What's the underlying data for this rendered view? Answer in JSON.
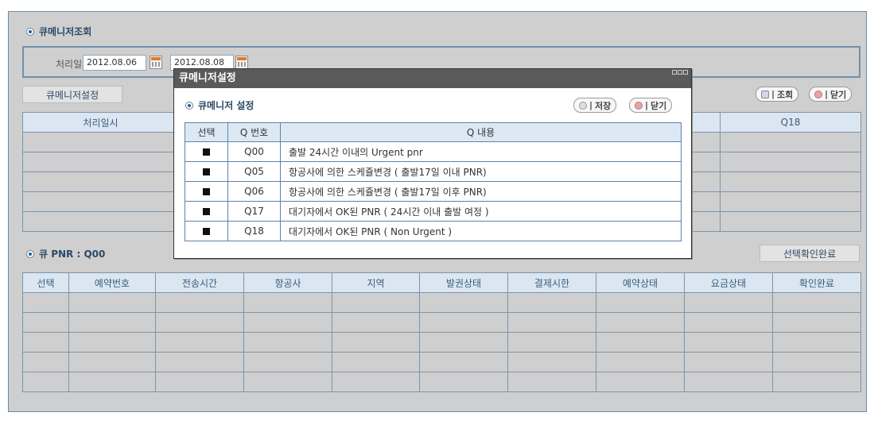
{
  "query": {
    "section_title": "큐메니저조회",
    "date_label": "처리일",
    "date_from": "2012.08.06",
    "date_to": "2012.08.08"
  },
  "settings_button": "큐메니저설정",
  "toolbar": {
    "search_label": "조회",
    "close_label": "닫기"
  },
  "q_table": {
    "headers": [
      "처리일시",
      "Q18"
    ],
    "row_count": 5
  },
  "pnr_section": {
    "title": "큐 PNR : Q00",
    "confirm_button": "선택확인완료",
    "headers": [
      "선택",
      "예약번호",
      "전송시간",
      "항공사",
      "지역",
      "발권상태",
      "결제시한",
      "예약상태",
      "요금상태",
      "확인완료"
    ],
    "row_count": 5
  },
  "modal": {
    "title": "큐메니저설정",
    "section_title": "큐메니저 설정",
    "save_label": "저장",
    "close_label": "닫기",
    "headers": [
      "선택",
      "Q 번호",
      "Q 내용"
    ],
    "rows": [
      {
        "checked": true,
        "qno": "Q00",
        "desc": "출발 24시간 이내의 Urgent pnr"
      },
      {
        "checked": true,
        "qno": "Q05",
        "desc": "항공사에 의한 스케쥴변경 ( 출발17일 이내 PNR)"
      },
      {
        "checked": true,
        "qno": "Q06",
        "desc": "항공사에 의한 스케쥴변경 ( 출발17일 이후 PNR)"
      },
      {
        "checked": true,
        "qno": "Q17",
        "desc": "대기자에서 OK된 PNR ( 24시간 이내 출발 여정 )"
      },
      {
        "checked": true,
        "qno": "Q18",
        "desc": "대기자에서 OK된 PNR ( Non Urgent )"
      }
    ]
  },
  "colors": {
    "border": "#6f90ae",
    "header_bg": "#dbe6f1",
    "titlebar": "#5a5a5a"
  }
}
